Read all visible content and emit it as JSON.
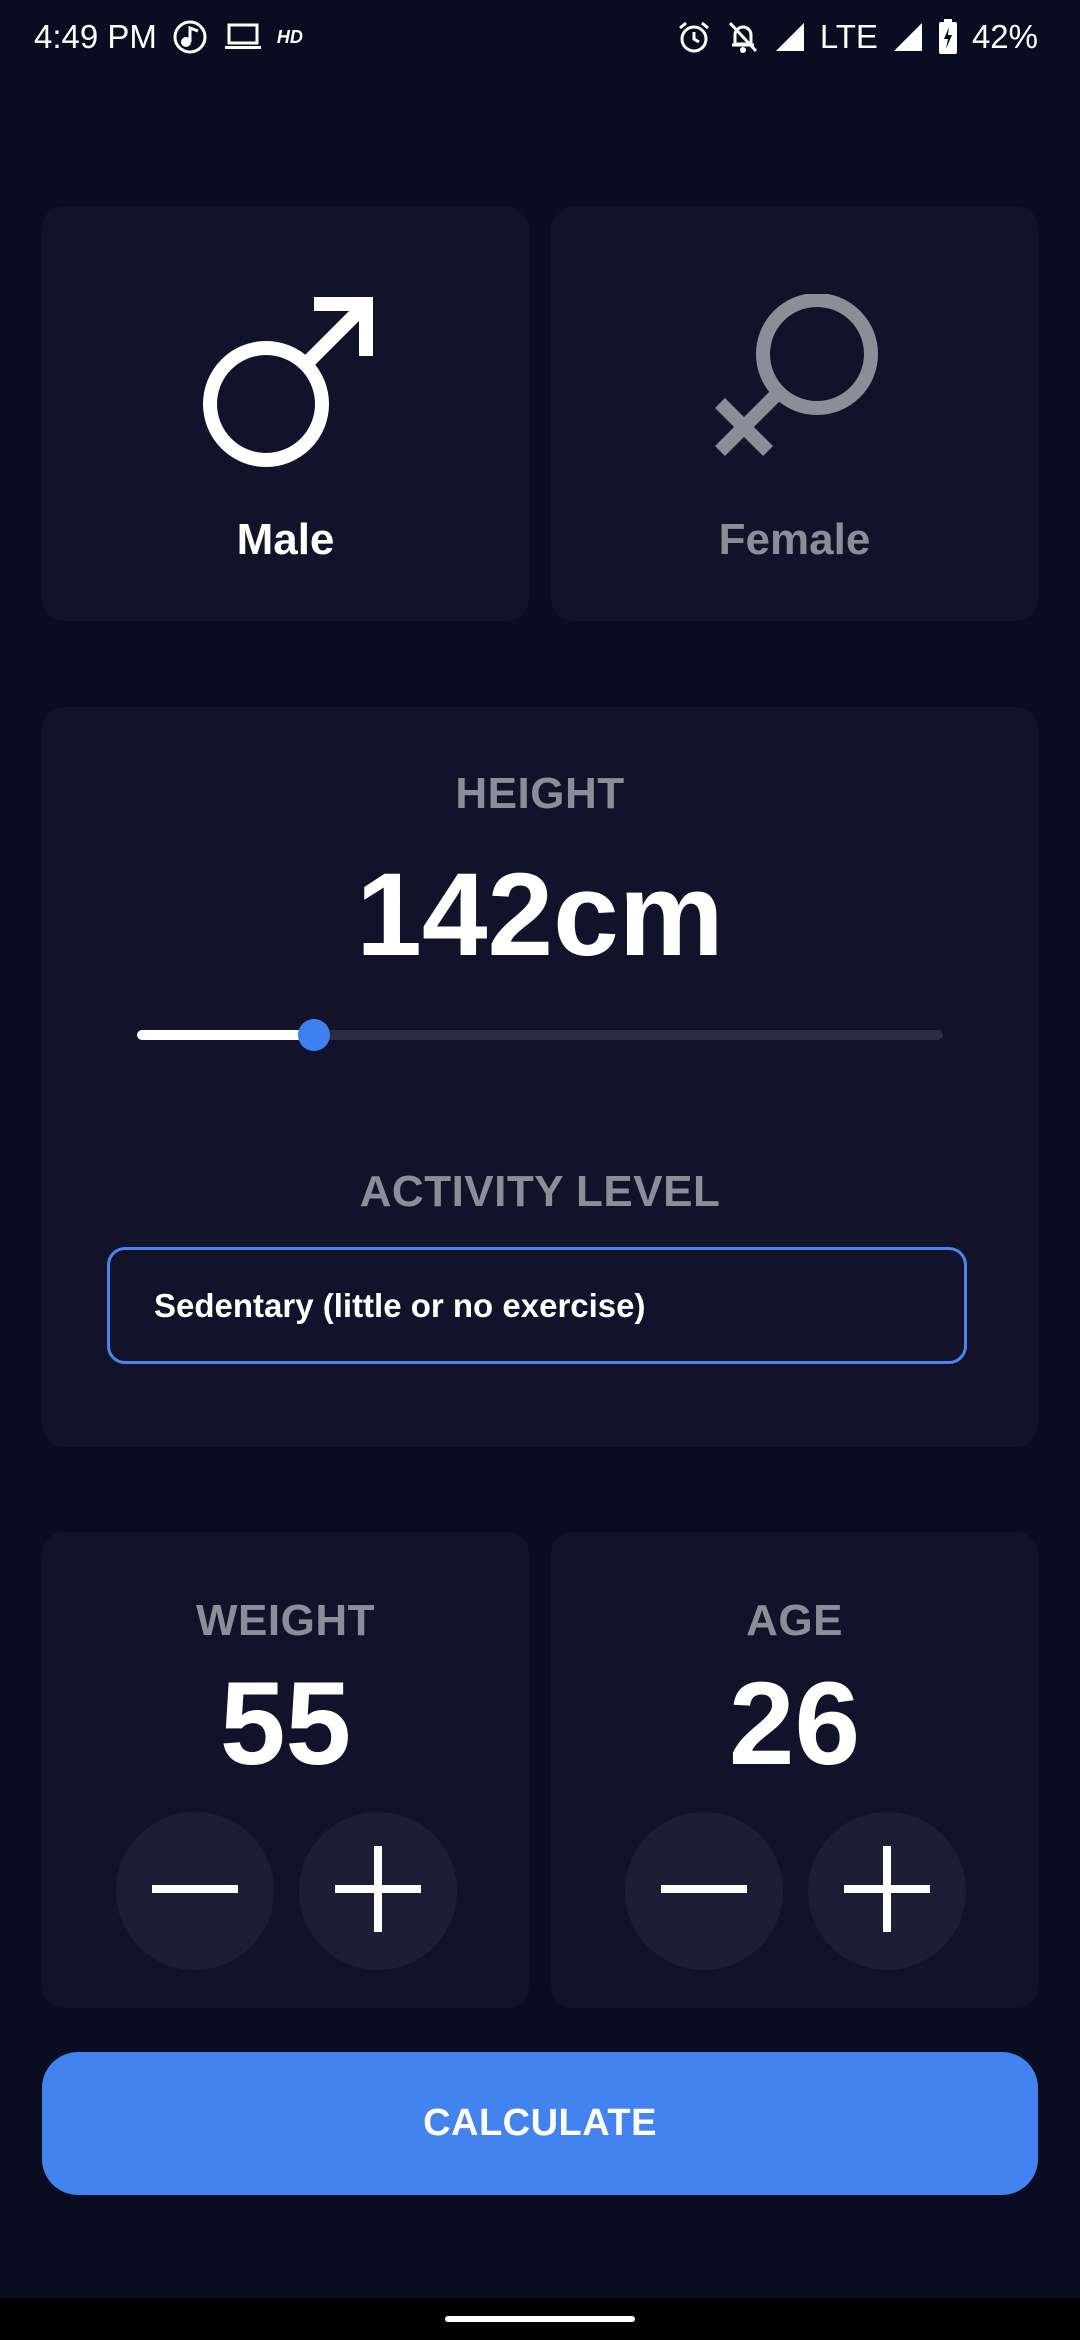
{
  "status_bar": {
    "time": "4:49 PM",
    "hd_label": "HD",
    "network": "LTE",
    "battery": "42%",
    "icons_left": [
      "music-notification-icon",
      "laptop-icon",
      "hd-icon"
    ],
    "icons_right": [
      "alarm-icon",
      "notifications-off-icon",
      "signal-icon",
      "signal-icon",
      "battery-charging-icon"
    ]
  },
  "gender": {
    "male_label": "Male",
    "female_label": "Female",
    "selected": "Male"
  },
  "height": {
    "label": "HEIGHT",
    "value": "142cm",
    "slider_fraction": 0.22
  },
  "activity": {
    "label": "ACTIVITY LEVEL",
    "selected": "Sedentary (little or no exercise)"
  },
  "weight": {
    "label": "WEIGHT",
    "value": "55"
  },
  "age": {
    "label": "AGE",
    "value": "26"
  },
  "calculate_label": "CALCULATE",
  "colors": {
    "background": "#0a0c22",
    "card": "#12132b",
    "accent": "#4283ef",
    "muted_text": "#8d8d99",
    "round_button": "#1d1e36"
  }
}
